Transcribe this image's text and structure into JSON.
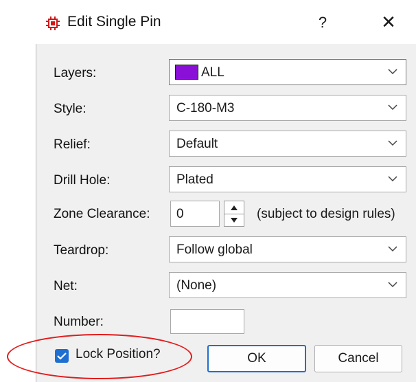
{
  "window": {
    "title": "Edit Single Pin",
    "help": "?",
    "close": "✕"
  },
  "fields": {
    "layers": {
      "label": "Layers:",
      "value": "ALL",
      "swatch_color": "#8a10d8"
    },
    "style": {
      "label": "Style:",
      "value": "C-180-M3"
    },
    "relief": {
      "label": "Relief:",
      "value": "Default"
    },
    "drill_hole": {
      "label": "Drill Hole:",
      "value": "Plated"
    },
    "zone_clearance": {
      "label": "Zone Clearance:",
      "value": "0",
      "note": "(subject to design rules)"
    },
    "teardrop": {
      "label": "Teardrop:",
      "value": "Follow global"
    },
    "net": {
      "label": "Net:",
      "value": "(None)"
    },
    "number": {
      "label": "Number:",
      "value": ""
    }
  },
  "lock_position": {
    "label": "Lock Position?",
    "checked": true
  },
  "buttons": {
    "ok": "OK",
    "cancel": "Cancel"
  },
  "colors": {
    "accent": "#1f6fd1",
    "highlight": "#e31b1b"
  }
}
